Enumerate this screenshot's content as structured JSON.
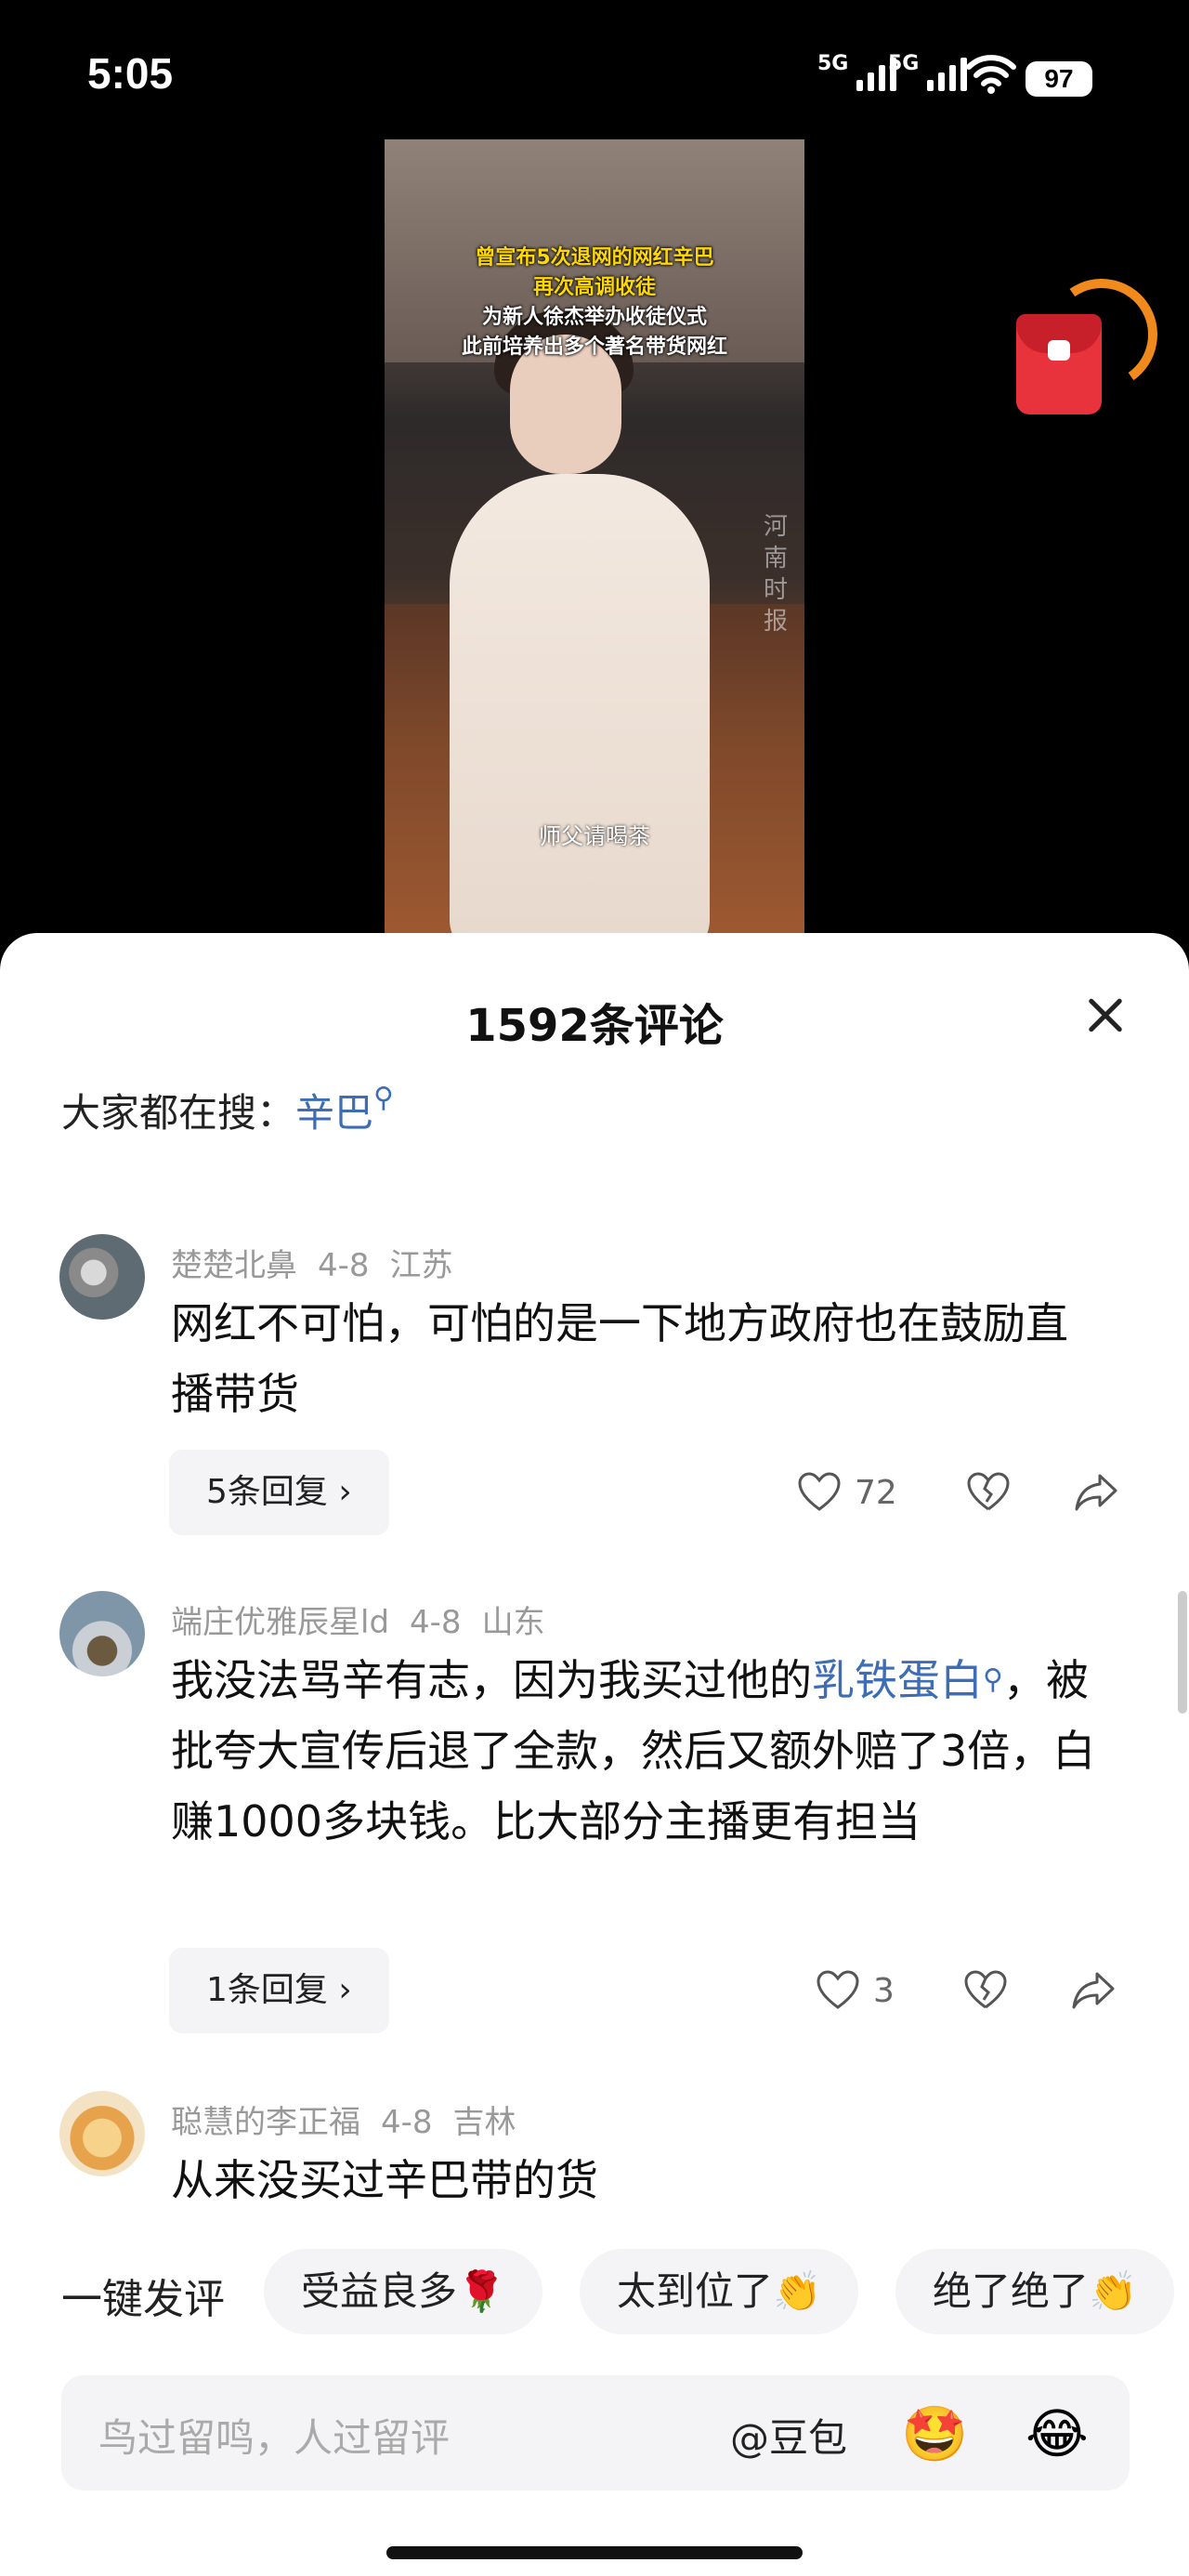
{
  "status_bar": {
    "time": "5:05",
    "signal1": "5G",
    "signal2": "5G",
    "battery": "97"
  },
  "video": {
    "caption_line1": "曾宣布5次退网的网红辛巴",
    "caption_line2": "再次高调收徒",
    "caption_line3": "为新人徐杰举办收徒仪式",
    "caption_line4": "此前培养出多个著名带货网红",
    "subtitle": "师父请喝茶",
    "watermark": "河南时报"
  },
  "comments_sheet": {
    "title": "1592条评论",
    "search_label": "大家都在搜：",
    "search_keyword": "辛巴",
    "comments": [
      {
        "user": "楚楚北鼻",
        "date": "4-8",
        "location": "江苏",
        "text": "网红不可怕，可怕的是一下地方政府也在鼓励直播带货",
        "replies": "5条回复 ›",
        "likes": "72"
      },
      {
        "user": "端庄优雅辰星ld",
        "date": "4-8",
        "location": "山东",
        "text_pre": "我没法骂辛有志，因为我买过他的",
        "text_kw": "乳铁蛋白",
        "text_post": "，被批夸大宣传后退了全款，然后又额外赔了3倍，白赚1000多块钱。比大部分主播更有担当",
        "replies": "1条回复 ›",
        "likes": "3"
      },
      {
        "user": "聪慧的李正福",
        "date": "4-8",
        "location": "吉林",
        "text": "从来没买过辛巴带的货"
      }
    ]
  },
  "quick_reply": {
    "label": "一键发评",
    "chips": [
      "受益良多🌹",
      "太到位了👏",
      "绝了绝了👏"
    ]
  },
  "input": {
    "placeholder": "鸟过留鸣，人过留评",
    "at_label": "@豆包",
    "emoji1": "🤩",
    "emoji2": "😂"
  }
}
